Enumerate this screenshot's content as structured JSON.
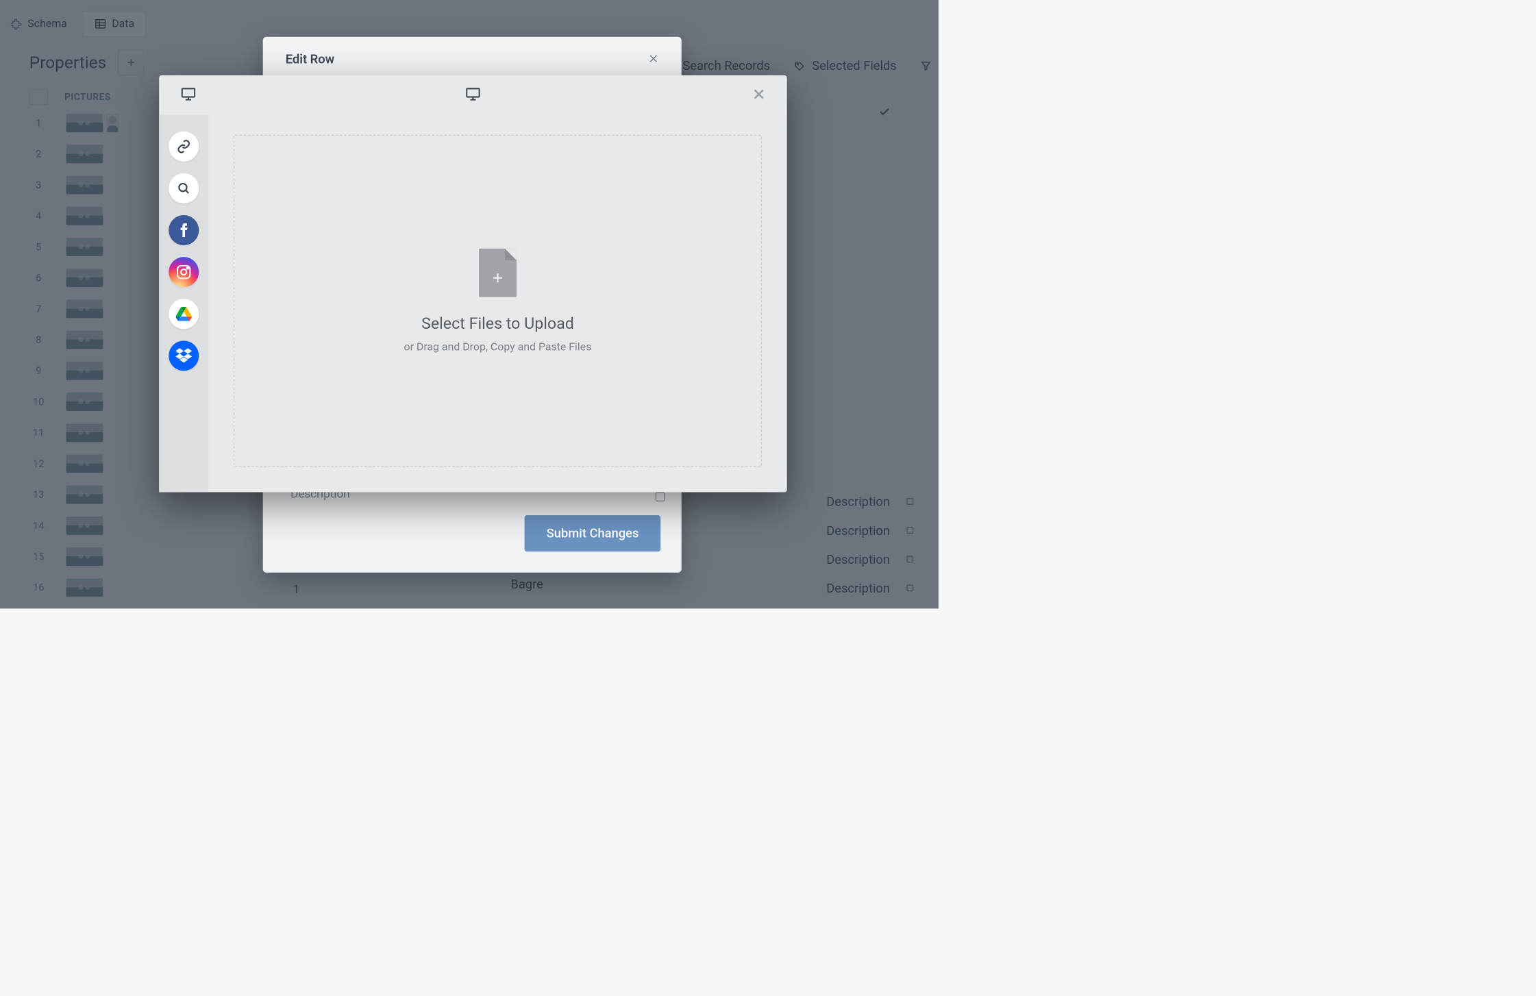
{
  "top_tabs": {
    "schema": "Schema",
    "data": "Data"
  },
  "left_panel": {
    "title": "Properties",
    "column_header": "PICTURES",
    "row_numbers": [
      "1",
      "2",
      "3",
      "4",
      "5",
      "6",
      "7",
      "8",
      "9",
      "10",
      "11",
      "12",
      "13",
      "14",
      "15",
      "16"
    ]
  },
  "right_tools": {
    "search_placeholder": "Search Records",
    "selected_fields": "Selected Fields"
  },
  "visible_cells": {
    "index_1": "1",
    "location_bagre": "Bagre",
    "description_label": "Description"
  },
  "edit_modal": {
    "title": "Edit Row",
    "description_label": "Description",
    "submit": "Submit Changes"
  },
  "picker": {
    "dropzone_title": "Select Files to Upload",
    "dropzone_sub": "or Drag and Drop, Copy and Paste Files",
    "sources": {
      "link": "link",
      "search": "search",
      "facebook": "facebook",
      "instagram": "instagram",
      "gdrive": "google-drive",
      "dropbox": "dropbox"
    }
  },
  "colors": {
    "overlay": "rgba(18,30,44,0.60)",
    "submit": "#6b93c2"
  }
}
